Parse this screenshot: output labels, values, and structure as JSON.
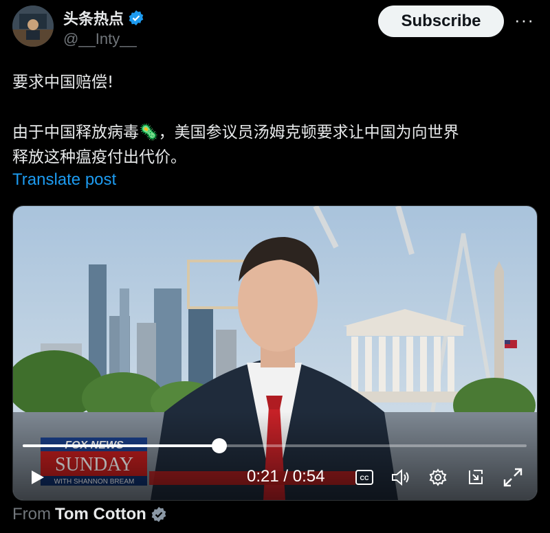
{
  "author": {
    "name": "头条热点",
    "handle": "@__Inty__"
  },
  "subscribe_label": "Subscribe",
  "more_label": "···",
  "post": {
    "line1": "要求中国赔偿!",
    "line2": "由于中国释放病毒🦠，美国参议员汤姆克顿要求让中国为向世界",
    "line3": "释放这种瘟疫付出代价。"
  },
  "translate_label": "Translate post",
  "video": {
    "time": "0:21 / 0:54",
    "progress": 0.39,
    "lower_third": {
      "brand": "FOX NEWS",
      "show": "SUNDAY",
      "host": "WITH SHANNON BREAM"
    },
    "cc_label": "CC"
  },
  "from": {
    "prefix": "From",
    "name": "Tom Cotton"
  },
  "colors": {
    "accent": "#1d9bf0",
    "verified": "#1d9bf0",
    "fox_red": "#c41e1e"
  }
}
